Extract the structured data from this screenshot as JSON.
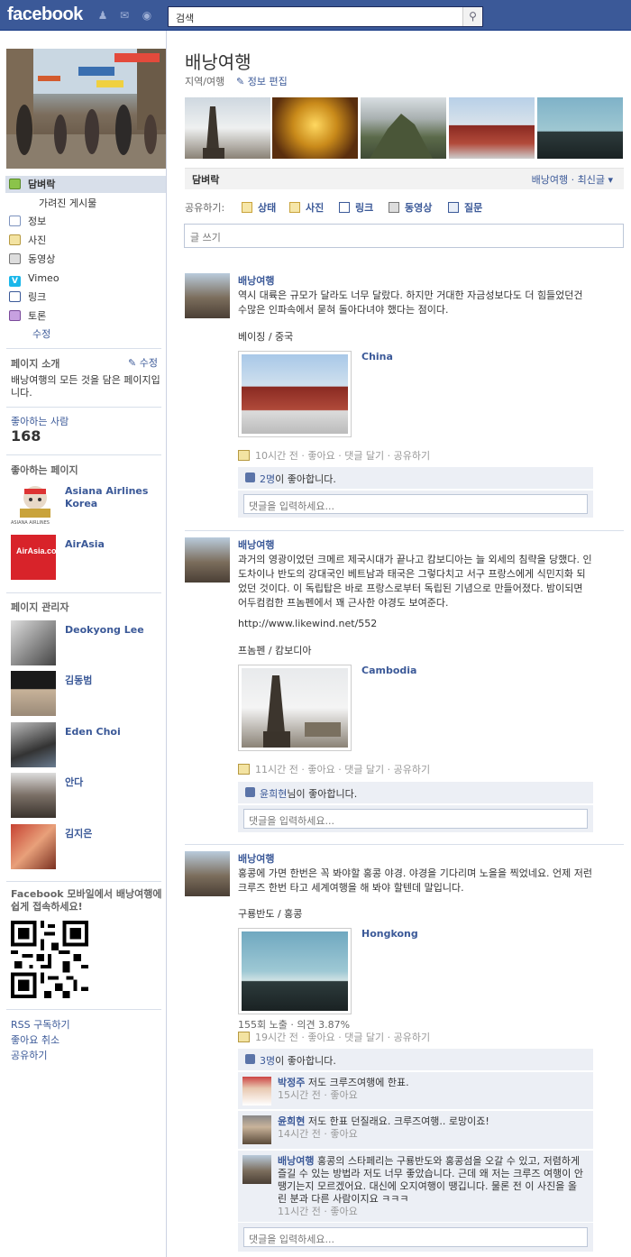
{
  "header": {
    "logo": "facebook",
    "search_placeholder": "검색"
  },
  "sidebar": {
    "nav": [
      {
        "label": "담벼락",
        "icon": "wall-icon"
      },
      {
        "label": "가려진 게시물",
        "icon": ""
      },
      {
        "label": "정보",
        "icon": "info-icon"
      },
      {
        "label": "사진",
        "icon": "photos-icon"
      },
      {
        "label": "동영상",
        "icon": "video-icon"
      },
      {
        "label": "Vimeo",
        "icon": "vimeo-icon"
      },
      {
        "label": "링크",
        "icon": "link-icon"
      },
      {
        "label": "토론",
        "icon": "discussion-icon"
      },
      {
        "label": "수정",
        "icon": ""
      }
    ],
    "about_title": "페이지 소개",
    "about_edit": "수정",
    "about_text": "배낭여행의 모든 것을 담은 페이지입니다.",
    "likes_title": "좋아하는 사람",
    "likes_count": "168",
    "liked_pages_title": "좋아하는 페이지",
    "liked_pages": [
      {
        "name": "Asiana Airlines Korea",
        "logo_text": "ASIANA AIRLINES"
      },
      {
        "name": "AirAsia",
        "logo_text": "AirAsia.com"
      }
    ],
    "admins_title": "페이지 관리자",
    "admins": [
      "Deokyong Lee",
      "김동범",
      "Eden Choi",
      "안다",
      "김지은"
    ],
    "mobile_text": "Facebook 모바일에서 배낭여행에 쉽게 접속하세요!",
    "footer_links": [
      "RSS 구독하기",
      "좋아요 취소",
      "공유하기"
    ]
  },
  "page": {
    "name": "배낭여행",
    "category": "지역/여행",
    "edit_info": "정보 편집",
    "wall_title": "담벼락",
    "filter": "배낭여행 · 최신글",
    "share_label": "공유하기:",
    "share_items": [
      "상태",
      "사진",
      "링크",
      "동영상",
      "질문"
    ],
    "composer_placeholder": "글 쓰기"
  },
  "posts": [
    {
      "author": "배낭여행",
      "text": "역시 대륙은 규모가 달라도 너무 달랐다. 하지만 거대한 자금성보다도 더 힘들었던건 수많은 인파속에서 묻혀 돌아다녀야 했다는 점이다.",
      "location": "베이징 / 중국",
      "caption": "China",
      "meta": "10시간 전 · 좋아요 · 댓글 달기 · 공유하기",
      "likes_count": "2명",
      "likes_suffix": "이 좋아합니다.",
      "comment_placeholder": "댓글을 입력하세요..."
    },
    {
      "author": "배낭여행",
      "text": "과거의 영광이었던 크메르 제국시대가 끝나고 캄보디아는 늘 외세의 침략을 당했다. 인도차이나 반도의 강대국인 베트남과 태국은 그렇다치고 서구 프랑스에게 식민지화 되었던 것이다. 이 독립탑은 바로 프랑스로부터 독립된 기념으로 만들어졌다. 밤이되면 어두컴컴한 프놈펜에서 꽤 근사한 야경도 보여준다.",
      "link": "http://www.likewind.net/552",
      "location": "프놈펜 / 캄보디아",
      "caption": "Cambodia",
      "meta": "11시간 전 · 좋아요 · 댓글 달기 · 공유하기",
      "likes_count": "윤희현",
      "likes_suffix": "님이 좋아합니다.",
      "comment_placeholder": "댓글을 입력하세요..."
    },
    {
      "author": "배낭여행",
      "text": "홍콩에 가면 한번은 꼭 봐야할 홍콩 야경. 야경을 기다리며 노을을 찍었네요. 언제 저런 크루즈 한번 타고 세계여행을 해 봐야 할텐데 말입니다.",
      "location": "구룡반도 / 홍콩",
      "caption": "Hongkong",
      "stats": "155회 노출 · 의견 3.87%",
      "meta": "19시간 전 · 좋아요 · 댓글 달기 · 공유하기",
      "likes_count": "3명",
      "likes_suffix": "이 좋아합니다.",
      "comments": [
        {
          "name": "박정주",
          "text": "저도 크루즈여행에 한표.",
          "time": "15시간 전 · 좋아요"
        },
        {
          "name": "윤희현",
          "text": "저도 한표 던질래요. 크루즈여행.. 로망이죠!",
          "time": "14시간 전 · 좋아요"
        },
        {
          "name": "배낭여행",
          "text": "홍콩의 스타페리는 구룡반도와 홍콩섬을 오갈 수 있고, 저렴하게 즐길 수 있는 방법라 저도 너무 좋았습니다. 근데 왜 저는 크루즈 여행이 안 땡기는지 모르겠어요. 대신에 오지여행이 땡깁니다. 물론 전 이 사진을 올린 분과 다른 사람이지요 ㅋㅋㅋ",
          "time": "11시간 전 · 좋아요"
        }
      ],
      "comment_placeholder": "댓글을 입력하세요..."
    }
  ]
}
